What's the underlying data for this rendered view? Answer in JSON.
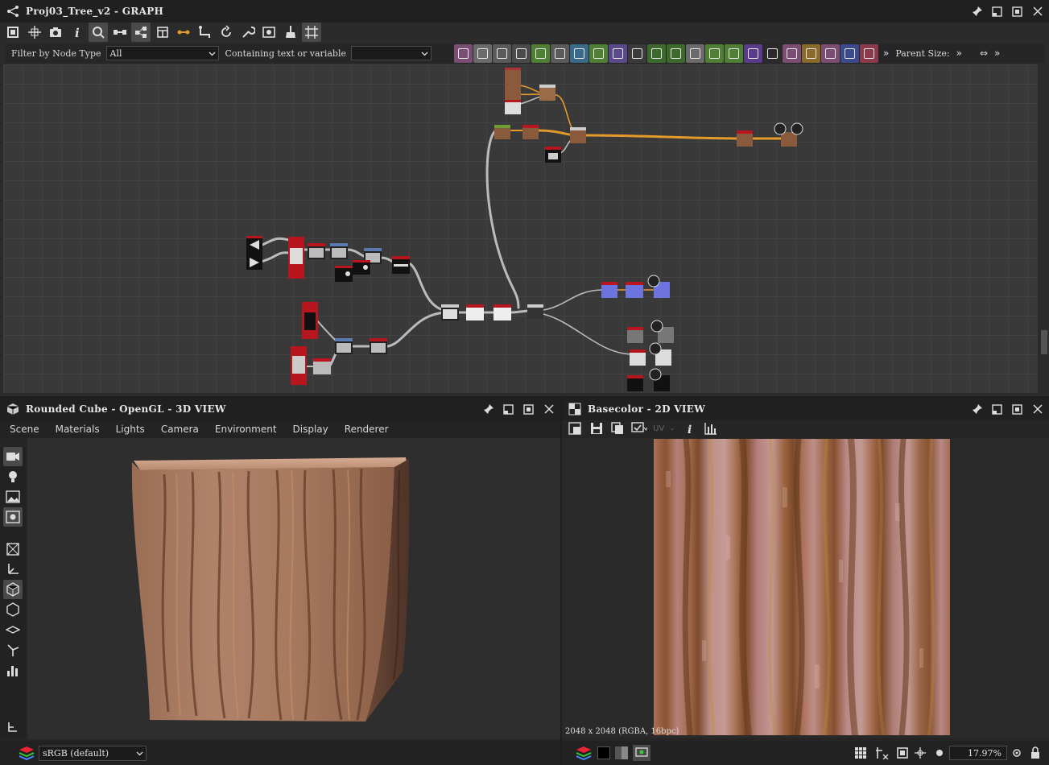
{
  "graph": {
    "title": "Proj03_Tree_v2 - GRAPH",
    "filter_label": "Filter by Node Type",
    "filter_value": "All",
    "contains_label": "Containing text or variable",
    "contains_value": "",
    "parent_size_label": "Parent Size:",
    "toolbar_icons": [
      "frame-all-icon",
      "fit-icon",
      "camera-icon",
      "info-icon",
      "search-icon",
      "link-icon",
      "hierarchy-icon",
      "layers-icon",
      "connect-icon",
      "route-icon",
      "refresh-icon",
      "wrench-icon",
      "bake-icon",
      "broom-icon",
      "grid-icon"
    ],
    "library_icons": [
      {
        "name": "image-node-icon",
        "color": "#7a4d72"
      },
      {
        "name": "bitmap-node-icon",
        "color": "#6a6a6a"
      },
      {
        "name": "drop-node-icon",
        "color": "#5a5a5a"
      },
      {
        "name": "shuffle-node-icon",
        "color": "#4a4a4a"
      },
      {
        "name": "curve-node-icon",
        "color": "#4f7f34"
      },
      {
        "name": "blend-node-icon",
        "color": "#5a5a5a"
      },
      {
        "name": "transform-node-icon",
        "color": "#3a6a8a"
      },
      {
        "name": "gradient-node-icon",
        "color": "#4f7f34"
      },
      {
        "name": "sphere-node-icon",
        "color": "#5a4a8a"
      },
      {
        "name": "tiles-node-icon",
        "color": "#3a3a3a"
      },
      {
        "name": "bake-node-icon",
        "color": "#3c6a2c"
      },
      {
        "name": "water-node-icon",
        "color": "#3c6a2c"
      },
      {
        "name": "slider-node-icon",
        "color": "#6a6a6a"
      },
      {
        "name": "contrast-node-icon",
        "color": "#4f7f34"
      },
      {
        "name": "histogram-node-icon",
        "color": "#4f7f34"
      },
      {
        "name": "color-wheel-node-icon",
        "color": "#5a3a8a"
      },
      {
        "name": "noise-node-icon",
        "color": "#2a2a2a"
      },
      {
        "name": "warp-node-icon",
        "color": "#7a4d72"
      },
      {
        "name": "mirror-node-icon",
        "color": "#8a6a2a"
      },
      {
        "name": "text-node-icon",
        "color": "#7a4d72"
      },
      {
        "name": "select-node-icon",
        "color": "#3a4a8a"
      },
      {
        "name": "fill-node-icon",
        "color": "#8a3a4a"
      }
    ]
  },
  "view3d": {
    "title": "Rounded Cube - OpenGL - 3D VIEW",
    "menu": [
      "Scene",
      "Materials",
      "Lights",
      "Camera",
      "Environment",
      "Display",
      "Renderer"
    ],
    "color_space": "sRGB (default)",
    "tools": [
      "camera-icon",
      "light-icon",
      "environment-icon",
      "settings-icon",
      "wireframe-icon",
      "axis-icon",
      "cube-icon",
      "cube-outline-icon",
      "plane-icon",
      "light-direction-icon",
      "stats-icon",
      "hierarchy-icon"
    ]
  },
  "view2d": {
    "title": "Basecolor - 2D VIEW",
    "uv_label": "UV",
    "info": "2048 x 2048 (RGBA, 16bpc)",
    "zoom": "17.97%",
    "tools": [
      "fit-icon",
      "save-icon",
      "copy-icon",
      "display-icon",
      "uv-icon",
      "info-icon",
      "histogram-icon"
    ]
  },
  "colors": {
    "accent_orange": "#e49a2b",
    "node_red": "#b8161f",
    "link_gray": "#b8b8b8"
  }
}
